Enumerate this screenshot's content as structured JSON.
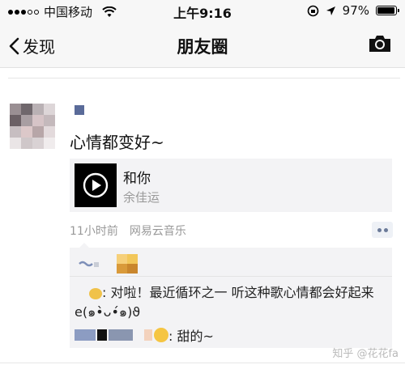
{
  "status_bar": {
    "carrier": "中国移动",
    "time": "上午9:16",
    "battery": "97%",
    "battery_level": 0.97
  },
  "nav": {
    "back_label": "发现",
    "title": "朋友圈"
  },
  "post": {
    "text": "心情都变好~",
    "music": {
      "song": "和你",
      "artist": "余佳运"
    },
    "time_ago": "11小时前",
    "source": "网易云音乐"
  },
  "comments": [
    {
      "text": ": 对啦！最近循环之一 听这种歌心情都会好起来e(๑•̀ᴗ•́๑)ϑ"
    },
    {
      "text": ": 甜的~"
    }
  ],
  "watermark": "知乎 @花花fa",
  "colors": {
    "nav_bg": "#f7f7f7",
    "username_blue": "#5a6b99",
    "meta_grey": "#999999",
    "comment_bg": "#f3f3f5"
  }
}
